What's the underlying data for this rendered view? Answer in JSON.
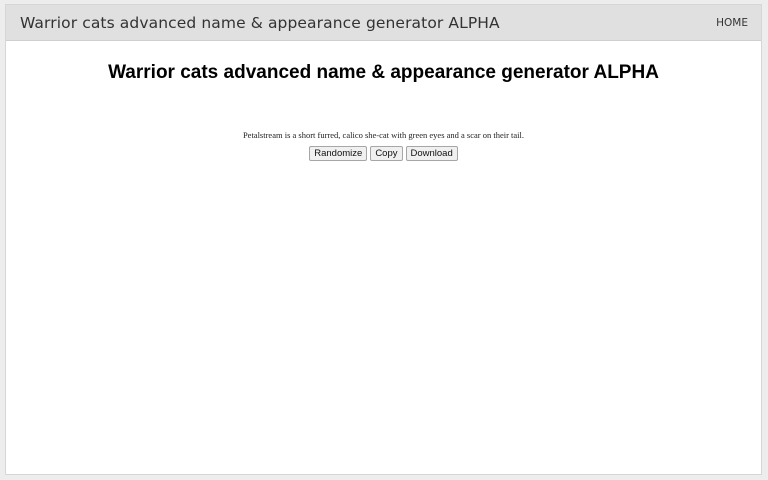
{
  "header": {
    "site_title": "Warrior cats advanced name & appearance generator ALPHA",
    "nav_home": "HOME"
  },
  "main": {
    "title": "Warrior cats advanced name & appearance generator ALPHA",
    "description": "Petalstream is a short furred, calico she-cat with green eyes and a scar on their tail."
  },
  "buttons": {
    "randomize": "Randomize",
    "copy": "Copy",
    "download": "Download"
  },
  "colors": {
    "header_bg": "#e0e0e0",
    "page_bg": "#ededed",
    "content_bg": "#ffffff"
  }
}
